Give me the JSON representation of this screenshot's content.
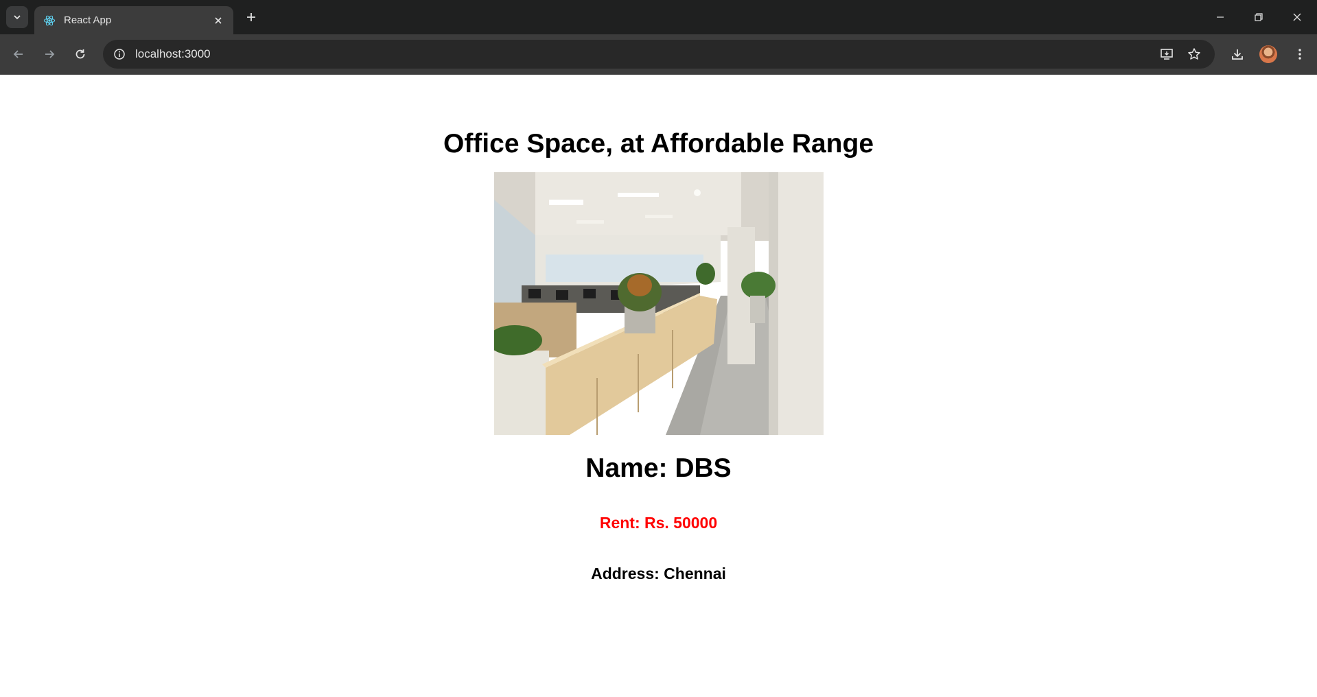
{
  "browser": {
    "tab_title": "React App",
    "url": "localhost:3000",
    "icon_color": "#e3e3e3",
    "icon_dim_color": "#9aa0a6",
    "favicon_color": "#61dafb"
  },
  "page": {
    "title": "Office Space, at Affordable Range",
    "image_alt": "office interior",
    "name_label": "Name: DBS",
    "rent_label": "Rent: Rs. 50000",
    "address_label": "Address: Chennai",
    "rent_color": "#ff0000"
  }
}
